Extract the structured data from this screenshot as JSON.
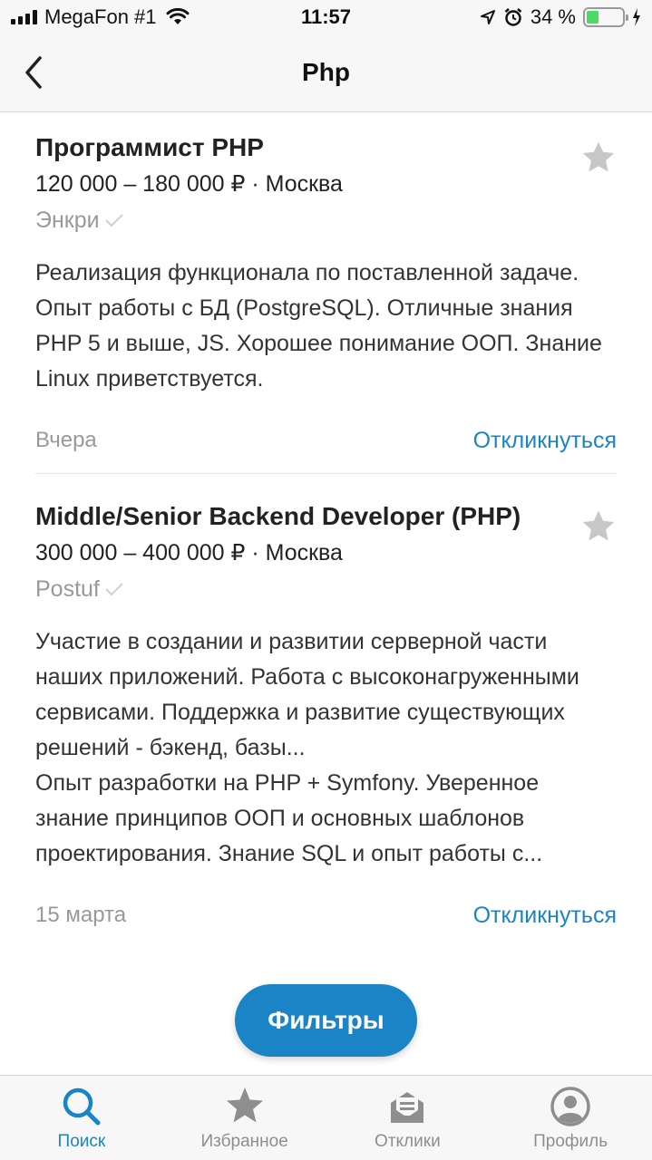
{
  "status_bar": {
    "carrier": "MegaFon #1",
    "time": "11:57",
    "battery_percent": "34 %",
    "battery_level": 0.34
  },
  "nav": {
    "title": "Php"
  },
  "vacancies": [
    {
      "title": "Программист PHP",
      "salary": "120 000 – 180 000 ₽ · Москва",
      "company": "Энкри",
      "description": "Реализация функционала по поставленной задаче.\nОпыт работы с БД (PostgreSQL). Отличные знания PHP 5 и выше, JS. Хорошее понимание ООП. Знание Linux приветствуется.",
      "date": "Вчера",
      "respond_label": "Откликнуться"
    },
    {
      "title": "Middle/Senior Backend Developer (PHP)",
      "salary": "300 000 – 400 000 ₽ · Москва",
      "company": "Postuf",
      "description": "Участие в создании и развитии серверной части наших приложений. Работа с высоконагруженными сервисами. Поддержка и развитие существующих решений - бэкенд, базы...\nОпыт разработки на PHP + Symfony. Уверенное знание принципов ООП и основных шаблонов проектирования. Знание SQL и опыт работы с...",
      "date": "15 марта",
      "respond_label": "Откликнуться"
    }
  ],
  "filters_button": "Фильтры",
  "tabs": [
    {
      "label": "Поиск",
      "icon": "search-icon",
      "active": true
    },
    {
      "label": "Избранное",
      "icon": "star-icon",
      "active": false
    },
    {
      "label": "Отклики",
      "icon": "responses-icon",
      "active": false
    },
    {
      "label": "Профиль",
      "icon": "profile-icon",
      "active": false
    }
  ],
  "colors": {
    "accent": "#1a84c6",
    "muted": "#999999",
    "battery": "#4cd964"
  }
}
